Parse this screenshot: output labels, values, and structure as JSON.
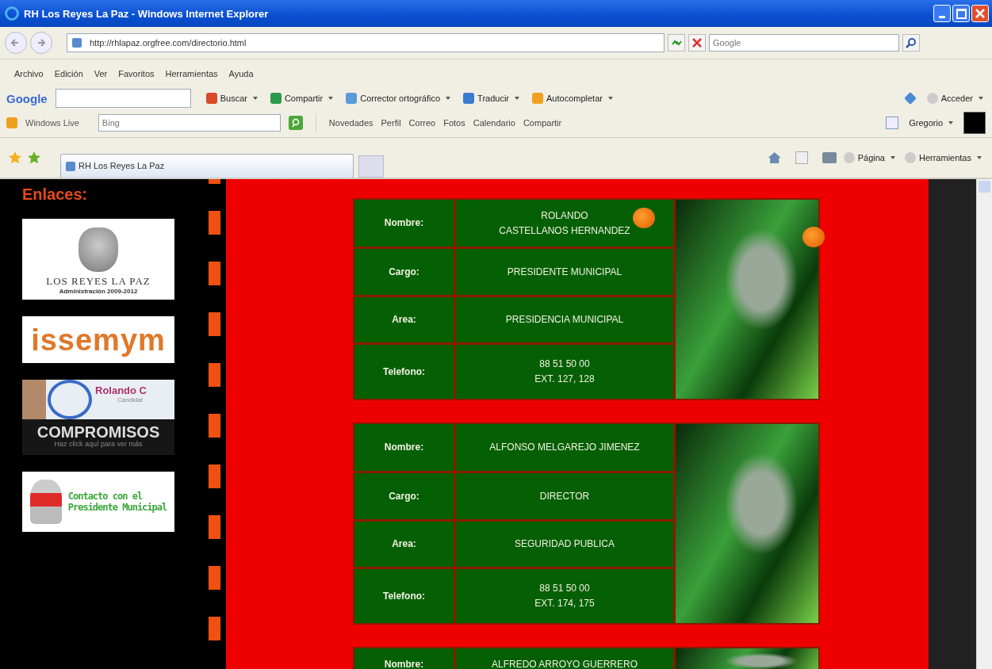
{
  "window": {
    "title": "RH Los Reyes La Paz - Windows Internet Explorer"
  },
  "address_bar": {
    "url": "http://rhlapaz.orgfree.com/directorio.html"
  },
  "search_box": {
    "placeholder": "Google"
  },
  "menu": [
    "Archivo",
    "Edición",
    "Ver",
    "Favoritos",
    "Herramientas",
    "Ayuda"
  ],
  "google_toolbar": {
    "logo": "Google",
    "items": [
      "Buscar",
      "Compartir",
      "Corrector ortográfico",
      "Traducir",
      "Autocompletar"
    ],
    "sign_in": "Acceder"
  },
  "live_toolbar": {
    "brand": "Windows Live",
    "search_placeholder": "Bing",
    "links": [
      "Novedades",
      "Perfil",
      "Correo",
      "Fotos",
      "Calendario",
      "Compartir"
    ],
    "user": "Gregorio"
  },
  "tabs": [
    {
      "label": "RH Los Reyes La Paz",
      "selected": true
    }
  ],
  "command_bar": [
    "Página",
    "Herramientas"
  ],
  "sidebar": {
    "heading": "Enlaces:",
    "banners": [
      {
        "kind": "municipio",
        "lines": [
          "LOS REYES LA PAZ",
          "Administración 2009-2012"
        ]
      },
      {
        "kind": "issemym",
        "lines": [
          "issemym"
        ]
      },
      {
        "kind": "compromisos",
        "lines": [
          "Rolando C",
          "Candidat",
          "COMPROMISOS",
          "Haz click aquí para ver más"
        ]
      },
      {
        "kind": "contacto",
        "lines": [
          "Contacto con el",
          "Presidente Municipal"
        ]
      }
    ]
  },
  "directory": [
    {
      "rows": [
        {
          "label": "Nombre:",
          "value": [
            "ROLANDO",
            "CASTELLANOS HERNANDEZ"
          ]
        },
        {
          "label": "Cargo:",
          "value": [
            "PRESIDENTE MUNICIPAL"
          ]
        },
        {
          "label": "Area:",
          "value": [
            "PRESIDENCIA MUNICIPAL"
          ]
        },
        {
          "label": "Telefono:",
          "value": [
            "88 51 50 00",
            "EXT. 127, 128"
          ]
        }
      ]
    },
    {
      "rows": [
        {
          "label": "Nombre:",
          "value": [
            "ALFONSO MELGAREJO JIMENEZ"
          ]
        },
        {
          "label": "Cargo:",
          "value": [
            "DIRECTOR"
          ]
        },
        {
          "label": "Area:",
          "value": [
            "SEGURIDAD PUBLICA"
          ]
        },
        {
          "label": "Telefono:",
          "value": [
            "88 51 50 00",
            "EXT. 174, 175"
          ]
        }
      ]
    },
    {
      "rows": [
        {
          "label": "Nombre:",
          "value": [
            "ALFREDO ARROYO GUERRERO"
          ]
        }
      ]
    }
  ]
}
